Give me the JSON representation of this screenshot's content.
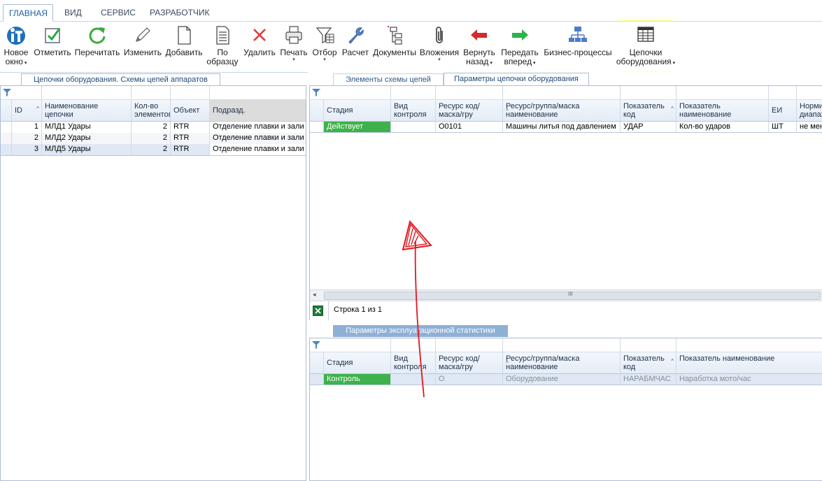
{
  "menu": {
    "tabs": [
      "ГЛАВНАЯ",
      "ВИД",
      "СЕРВИС",
      "РАЗРАБОТЧИК"
    ]
  },
  "ribbon": {
    "new_window": [
      "Новое",
      "окно"
    ],
    "mark": "Отметить",
    "reread": "Перечитать",
    "edit": "Изменить",
    "add": "Добавить",
    "by_sample": [
      "По",
      "образцу"
    ],
    "delete": "Удалить",
    "print": "Печать",
    "filter": "Отбор",
    "calc": "Расчет",
    "documents": "Документы",
    "attachments": "Вложения",
    "return_back": [
      "Вернуть",
      "назад"
    ],
    "forward": [
      "Передать",
      "вперед"
    ],
    "business_processes": "Бизнес-процессы",
    "equipment_chains": [
      "Цепочки",
      "оборудования"
    ]
  },
  "left_panel": {
    "tab": "Цепочки оборудования. Схемы цепей аппаратов",
    "columns": [
      "ID",
      "Наименование цепочки",
      "Кол-во элементов",
      "Объект",
      "Подразд."
    ],
    "rows": [
      {
        "id": "1",
        "name": "МЛД1 Удары",
        "count": "2",
        "object": "RTR",
        "dept": "Отделение плавки и зали"
      },
      {
        "id": "2",
        "name": "МЛД2 Удары",
        "count": "2",
        "object": "RTR",
        "dept": "Отделение плавки и зали"
      },
      {
        "id": "3",
        "name": "МЛД5 Удары",
        "count": "2",
        "object": "RTR",
        "dept": "Отделение плавки и зали"
      }
    ]
  },
  "right_top": {
    "tabs": [
      "Элементы схемы цепей",
      "Параметры цепочки оборудования"
    ],
    "columns": [
      "Стадия",
      "Вид контроля",
      "Ресурс код/маска/гру",
      "Ресурс/группа/маска наименование",
      "Показатель код",
      "Показатель наименование",
      "ЕИ",
      "Норми диапаз"
    ],
    "rows": [
      {
        "stage": "Действует",
        "control": "",
        "res_code": "О0101",
        "res_name": "Машины литья под давлением",
        "ind_code": "УДАР",
        "ind_name": "Кол-во ударов",
        "unit": "ШТ",
        "norm": "не мен"
      }
    ],
    "status": "Строка 1 из 1",
    "scroll_grip": "III"
  },
  "right_bottom": {
    "tab": "Параметры эксплуатационной статистики",
    "columns": [
      "Стадия",
      "Вид контроля",
      "Ресурс код/маска/гру",
      "Ресурс/группа/маска наименование",
      "Показатель код",
      "Показатель наименование"
    ],
    "rows": [
      {
        "stage": "Контроль",
        "control": "",
        "res_code": "О",
        "res_name": "Оборудование",
        "ind_code": "НАРАБМЧАС",
        "ind_name": "Наработка мото/час"
      }
    ]
  },
  "colors": {
    "highlight": "#ffff1a",
    "stage_green": "#3db24a",
    "annotation_red": "#e4161b"
  }
}
